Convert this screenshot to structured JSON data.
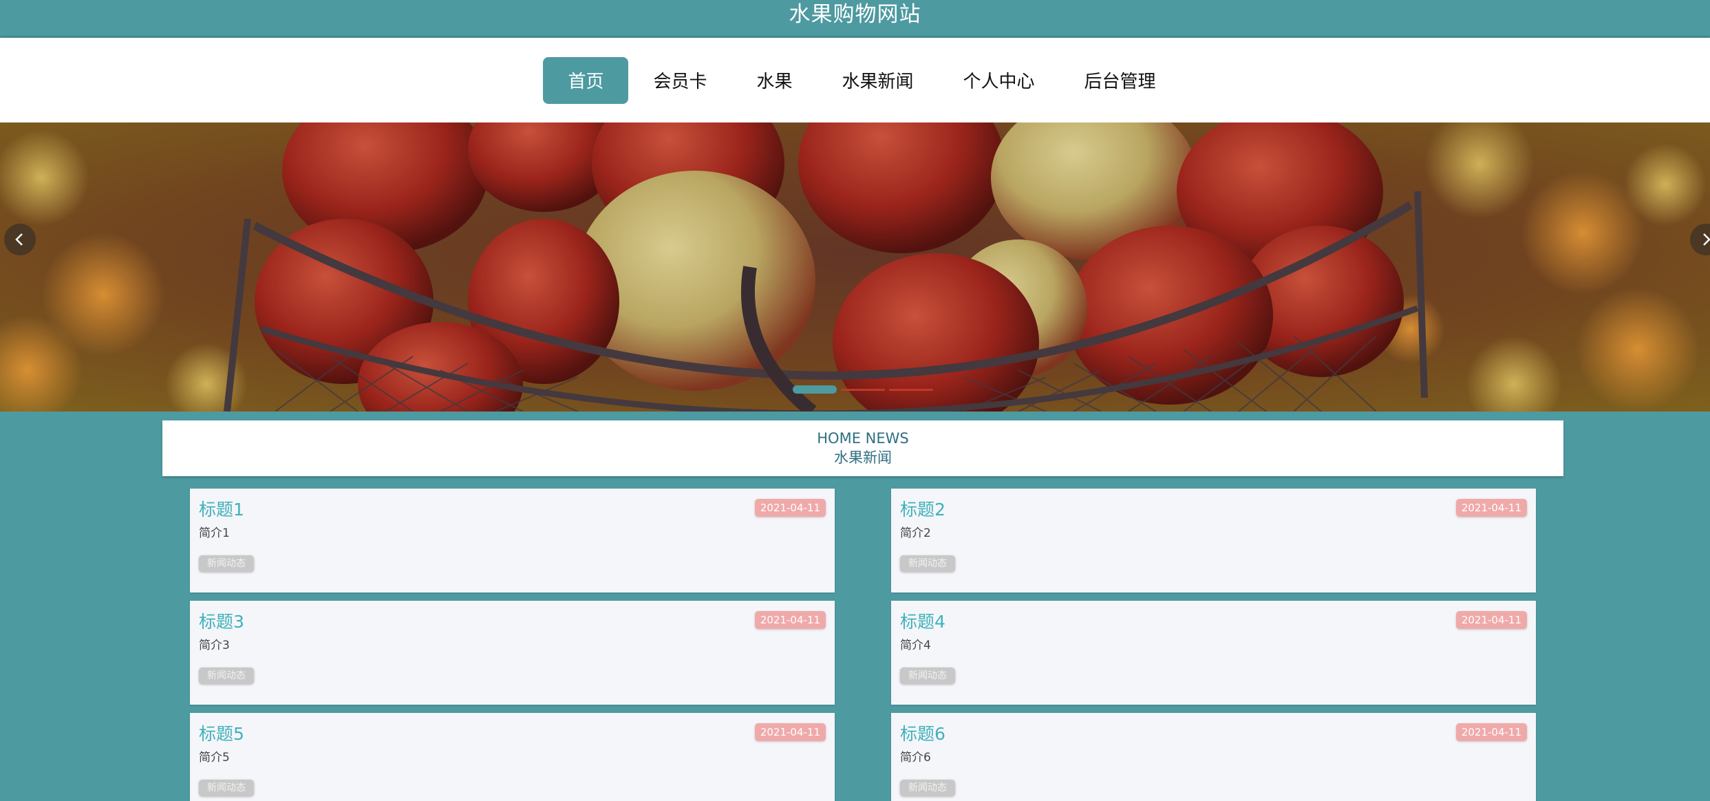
{
  "header": {
    "site_title": "水果购物网站"
  },
  "nav": {
    "items": [
      {
        "label": "首页",
        "active": true
      },
      {
        "label": "会员卡",
        "active": false
      },
      {
        "label": "水果",
        "active": false
      },
      {
        "label": "水果新闻",
        "active": false
      },
      {
        "label": "个人中心",
        "active": false
      },
      {
        "label": "后台管理",
        "active": false
      }
    ]
  },
  "banner": {
    "image": "apples-in-wire-basket",
    "prev_icon": "chevron-left-icon",
    "next_icon": "chevron-right-icon",
    "slide_count": 3,
    "active_slide": 1
  },
  "section": {
    "title_en": "HOME NEWS",
    "title_zh": "水果新闻"
  },
  "news": [
    {
      "title": "标题1",
      "summary": "简介1",
      "date": "2021-04-11",
      "tag": "新闻动态"
    },
    {
      "title": "标题2",
      "summary": "简介2",
      "date": "2021-04-11",
      "tag": "新闻动态"
    },
    {
      "title": "标题3",
      "summary": "简介3",
      "date": "2021-04-11",
      "tag": "新闻动态"
    },
    {
      "title": "标题4",
      "summary": "简介4",
      "date": "2021-04-11",
      "tag": "新闻动态"
    },
    {
      "title": "标题5",
      "summary": "简介5",
      "date": "2021-04-11",
      "tag": "新闻动态"
    },
    {
      "title": "标题6",
      "summary": "简介6",
      "date": "2021-04-11",
      "tag": "新闻动态"
    }
  ],
  "colors": {
    "primary": "#4d9aa0",
    "title_teal": "#3fb1bb",
    "date_badge": "#f0a9a9",
    "tag_badge": "#c8c8c8"
  }
}
